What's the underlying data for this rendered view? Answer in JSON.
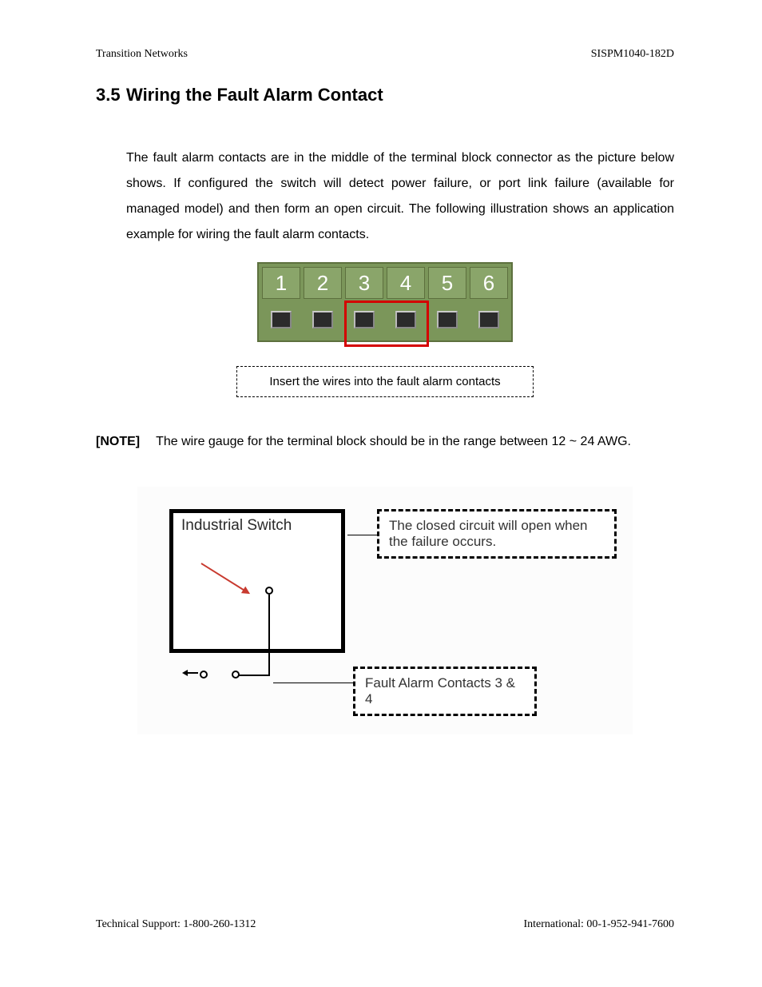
{
  "header": {
    "left": "Transition Networks",
    "right": "SISPM1040-182D"
  },
  "section": {
    "number": "3.5",
    "title": "Wiring the Fault Alarm Contact"
  },
  "paragraph": "The fault alarm contacts are in the middle of the terminal block connector as the picture below shows. If configured the switch will detect power failure, or port link failure (available for managed model) and then form an open circuit. The following illustration shows an application example for wiring the fault alarm contacts.",
  "terminal_labels": [
    "1",
    "2",
    "3",
    "4",
    "5",
    "6"
  ],
  "callout": "Insert the wires into the fault alarm contacts",
  "note": {
    "label": "[NOTE]",
    "text": "The wire gauge for the terminal block should be in the range between 12 ~ 24 AWG."
  },
  "diagram": {
    "switch_label": "Industrial Switch",
    "box_top": "The closed circuit will open when the failure occurs.",
    "box_bottom": "Fault Alarm Contacts 3 & 4"
  },
  "footer": {
    "left": "Technical Support: 1-800-260-1312",
    "right": "International: 00-1-952-941-7600"
  }
}
